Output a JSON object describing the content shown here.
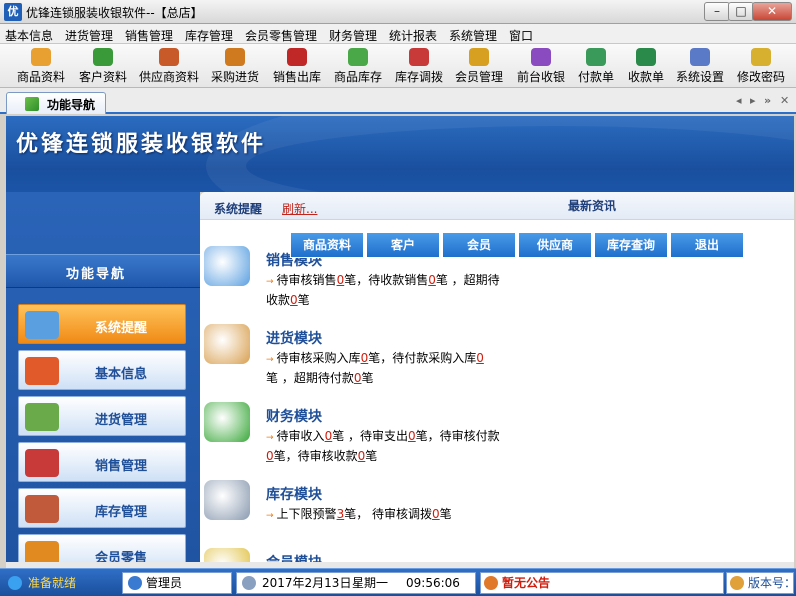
{
  "window": {
    "app_icon_text": "优",
    "title": "优锋连锁服装收银软件--【总店】",
    "minimize": "–",
    "maximize": "□",
    "close": "✕"
  },
  "menu": [
    "基本信息",
    "进货管理",
    "销售管理",
    "库存管理",
    "会员零售管理",
    "财务管理",
    "统计报表",
    "系统管理",
    "窗口"
  ],
  "toolbar": [
    {
      "label": "商品资料",
      "icon": "box-icon",
      "color": "#e8a030"
    },
    {
      "label": "客户资料",
      "icon": "people-icon",
      "color": "#3a9a3a"
    },
    {
      "label": "供应商资料",
      "icon": "supplier-icon",
      "color": "#c85a2a"
    },
    {
      "label": "采购进货",
      "icon": "purchase-icon",
      "color": "#d07a20"
    },
    {
      "label": "销售出库",
      "icon": "sales-icon",
      "color": "#c02828"
    },
    {
      "label": "商品库存",
      "icon": "stock-icon",
      "color": "#4aa848"
    },
    {
      "label": "库存调拨",
      "icon": "transfer-icon",
      "color": "#c83a3a"
    },
    {
      "label": "会员管理",
      "icon": "member-icon",
      "color": "#d8a020"
    },
    {
      "label": "前台收银",
      "icon": "cashier-icon",
      "color": "#8a4ac0"
    },
    {
      "label": "付款单",
      "icon": "payment-icon",
      "color": "#3a9a5a"
    },
    {
      "label": "收款单",
      "icon": "receipt-icon",
      "color": "#2a8a4a"
    },
    {
      "label": "系统设置",
      "icon": "settings-icon",
      "color": "#5a7ac8"
    },
    {
      "label": "修改密码",
      "icon": "key-icon",
      "color": "#d8b030"
    }
  ],
  "tab": {
    "label": "功能导航",
    "controls": [
      "◂",
      "▸",
      "»",
      "✕"
    ]
  },
  "banner": {
    "title": "优锋连锁服装收银软件"
  },
  "sidebar": {
    "heading": "功能导航",
    "items": [
      {
        "label": "系统提醒",
        "icon": "monitor-icon",
        "color": "#5aa0e0"
      },
      {
        "label": "基本信息",
        "icon": "folder-icon",
        "color": "#e05a2a"
      },
      {
        "label": "进货管理",
        "icon": "cart-in-icon",
        "color": "#6aaa4a"
      },
      {
        "label": "销售管理",
        "icon": "cart-out-icon",
        "color": "#c83a3a"
      },
      {
        "label": "库存管理",
        "icon": "warehouse-icon",
        "color": "#c05a3a"
      },
      {
        "label": "会员零售",
        "icon": "member-retail-icon",
        "color": "#e08a20"
      }
    ]
  },
  "content": {
    "system_reminder": "系统提醒",
    "refresh": "刷新...",
    "news_title": "最新资讯",
    "quick_buttons": [
      "商品资料",
      "客户",
      "会员",
      "供应商",
      "库存查询",
      "退出"
    ],
    "modules": [
      {
        "title": "销售模块",
        "icon": "sales-module-icon",
        "color": "#5aa0e0",
        "lines": [
          [
            [
              "待审核销售",
              false
            ],
            [
              "0",
              true
            ],
            [
              "笔，待收款销售",
              false
            ],
            [
              "0",
              true
            ],
            [
              "笔 ，超期待",
              false
            ]
          ],
          [
            [
              "收款",
              false
            ],
            [
              "0",
              true
            ],
            [
              "笔",
              false
            ]
          ]
        ]
      },
      {
        "title": "进货模块",
        "icon": "purchase-module-icon",
        "color": "#d8a050",
        "lines": [
          [
            [
              "待审核采购入库",
              false
            ],
            [
              "0",
              true
            ],
            [
              "笔，待付款采购入库",
              false
            ],
            [
              "0",
              true
            ]
          ],
          [
            [
              "笔 ，超期待付款",
              false
            ],
            [
              "0",
              true
            ],
            [
              "笔",
              false
            ]
          ]
        ]
      },
      {
        "title": "财务模块",
        "icon": "finance-module-icon",
        "color": "#3aa83a",
        "lines": [
          [
            [
              "待审收入",
              false
            ],
            [
              "0",
              true
            ],
            [
              "笔 ，待审支出",
              false
            ],
            [
              "0",
              true
            ],
            [
              "笔，待审核付款",
              false
            ]
          ],
          [
            [
              "0",
              true
            ],
            [
              "笔，待审核收款",
              false
            ],
            [
              "0",
              true
            ],
            [
              "笔",
              false
            ]
          ]
        ]
      },
      {
        "title": "库存模块",
        "icon": "stock-module-icon",
        "color": "#8a9ab0",
        "lines": [
          [
            [
              "上下限预警",
              false
            ],
            [
              "3",
              true
            ],
            [
              "笔，  待审核调拨",
              false
            ],
            [
              "0",
              true
            ],
            [
              "笔",
              false
            ]
          ]
        ]
      },
      {
        "title": "会员模块",
        "icon": "member-module-icon",
        "color": "#e0c040",
        "lines": []
      }
    ]
  },
  "status": {
    "ready": "准备就绪",
    "user": "管理员",
    "date": "2017年2月13日",
    "weekday": "星期一",
    "time": "09:56:06",
    "announcement": "暂无公告",
    "version_label": "版本号："
  }
}
